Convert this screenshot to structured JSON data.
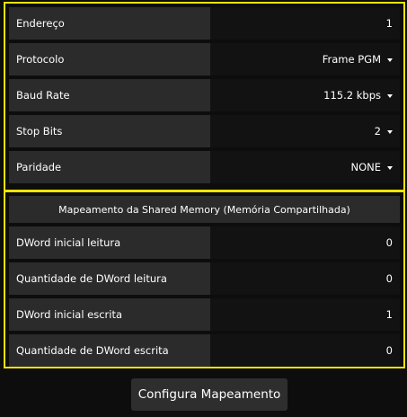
{
  "serial": {
    "rows": [
      {
        "label": "Endereço",
        "value": "1",
        "dropdown": false
      },
      {
        "label": "Protocolo",
        "value": "Frame PGM",
        "dropdown": true
      },
      {
        "label": "Baud Rate",
        "value": "115.2 kbps",
        "dropdown": true
      },
      {
        "label": "Stop Bits",
        "value": "2",
        "dropdown": true
      },
      {
        "label": "Paridade",
        "value": "NONE",
        "dropdown": true
      }
    ]
  },
  "shared": {
    "title": "Mapeamento da Shared Memory (Memória Compartilhada)",
    "rows": [
      {
        "label": "DWord inicial leitura",
        "value": "0"
      },
      {
        "label": "Quantidade de DWord leitura",
        "value": "0"
      },
      {
        "label": "DWord inicial escrita",
        "value": "1"
      },
      {
        "label": "Quantidade de DWord escrita",
        "value": "0"
      }
    ]
  },
  "actions": {
    "configure_label": "Configura Mapeamento"
  },
  "colors": {
    "highlight_border": "#f2e400",
    "label_bg": "#2b2b2b",
    "value_bg": "#121212",
    "page_bg": "#0d0d0d"
  },
  "icons": {
    "dropdown": "caret-down-icon"
  }
}
